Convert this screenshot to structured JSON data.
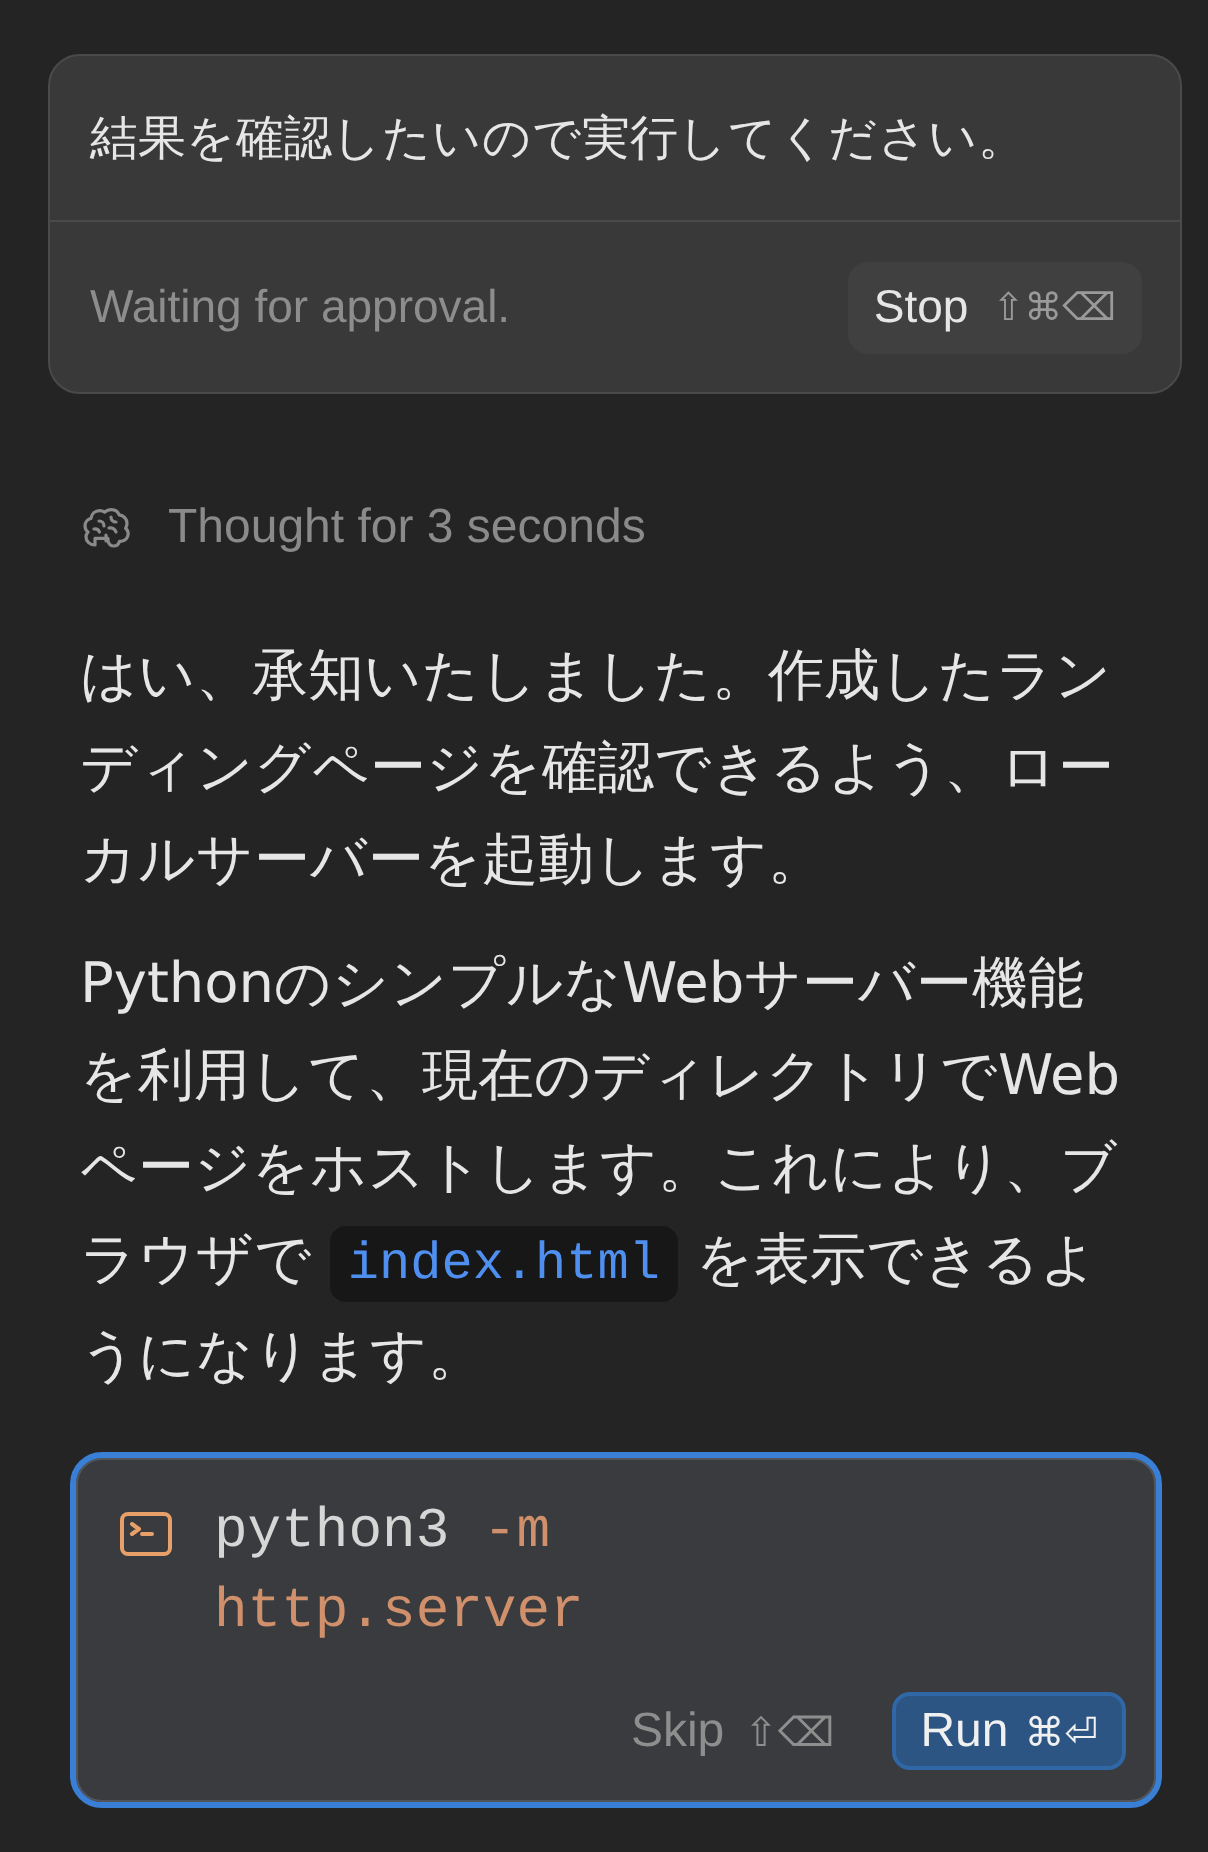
{
  "prompt_card": {
    "message": "結果を確認したいので実行してください。",
    "status": "Waiting for approval.",
    "stop_button": {
      "label": "Stop",
      "shortcut": "⇧⌘⌫"
    }
  },
  "thought": {
    "label": "Thought for 3 seconds"
  },
  "paragraphs": [
    {
      "segments": [
        {
          "kind": "text",
          "text": "はい、承知いたしました。作成したランディングページを確認できるよう、ローカルサーバーを起動します。"
        }
      ]
    },
    {
      "segments": [
        {
          "kind": "text",
          "text": "PythonのシンプルなWebサーバー機能を利用して、現在のディレクトリでWebページをホストします。これにより、ブラウザで "
        },
        {
          "kind": "code",
          "text": "index.html"
        },
        {
          "kind": "text",
          "text": " を表示できるようになります。"
        }
      ]
    }
  ],
  "command_card": {
    "focused": true,
    "tokens": [
      {
        "kind": "command",
        "text": "python3"
      },
      {
        "kind": "flag",
        "text": "-m"
      },
      {
        "kind": "argument",
        "text": "http.server"
      }
    ],
    "skip_button": {
      "label": "Skip",
      "shortcut": "⇧⌫"
    },
    "run_button": {
      "label": "Run",
      "shortcut": "⌘⏎"
    }
  }
}
